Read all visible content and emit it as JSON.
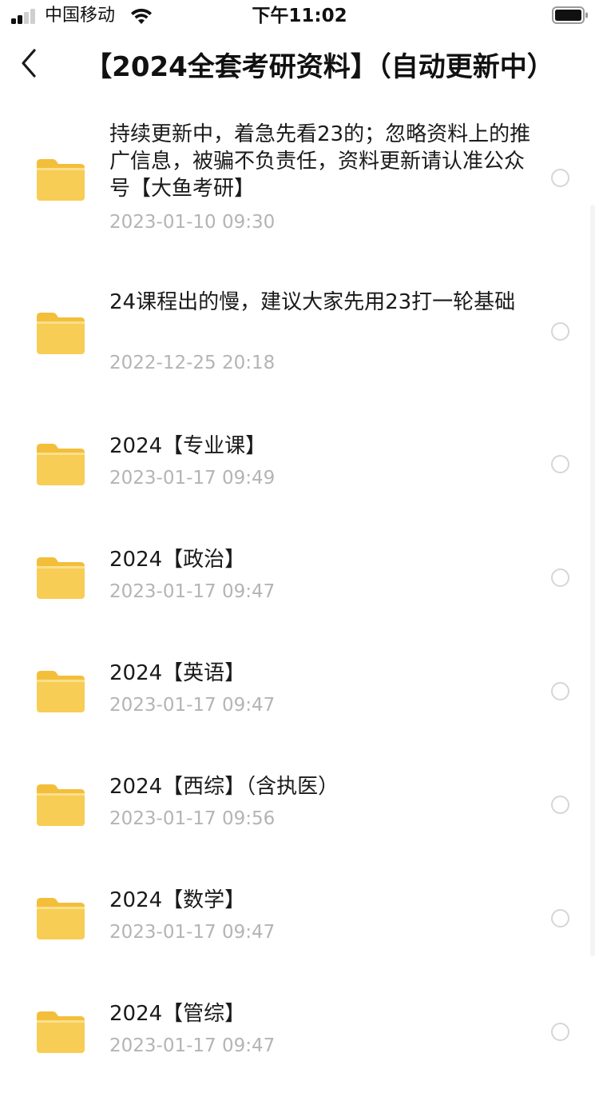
{
  "status_bar": {
    "carrier": "中国移动",
    "time": "下午11:02"
  },
  "nav": {
    "back_icon": "chevron-left-icon",
    "title": "【2024全套考研资料】（自动更新中）"
  },
  "files": [
    {
      "name": "持续更新中，着急先看23的；忽略资料上的推广信息，被骗不负责任，资料更新请认准公众号【大鱼考研】",
      "date": "2023-01-10 09:30",
      "icon": "folder-icon"
    },
    {
      "name": "24课程出的慢，建议大家先用23打一轮基础",
      "date": "2022-12-25 20:18",
      "icon": "folder-icon"
    },
    {
      "name": "2024【专业课】",
      "date": "2023-01-17 09:49",
      "icon": "folder-icon"
    },
    {
      "name": "2024【政治】",
      "date": "2023-01-17 09:47",
      "icon": "folder-icon"
    },
    {
      "name": "2024【英语】",
      "date": "2023-01-17 09:47",
      "icon": "folder-icon"
    },
    {
      "name": "2024【西综】（含执医）",
      "date": "2023-01-17 09:56",
      "icon": "folder-icon"
    },
    {
      "name": "2024【数学】",
      "date": "2023-01-17 09:47",
      "icon": "folder-icon"
    },
    {
      "name": "2024【管综】",
      "date": "2023-01-17 09:47",
      "icon": "folder-icon"
    }
  ],
  "colors": {
    "folder_body": "#f8cd55",
    "folder_tab": "#f3be3a",
    "date_text": "#b4b4b4",
    "radio_border": "#d6d6d6"
  }
}
